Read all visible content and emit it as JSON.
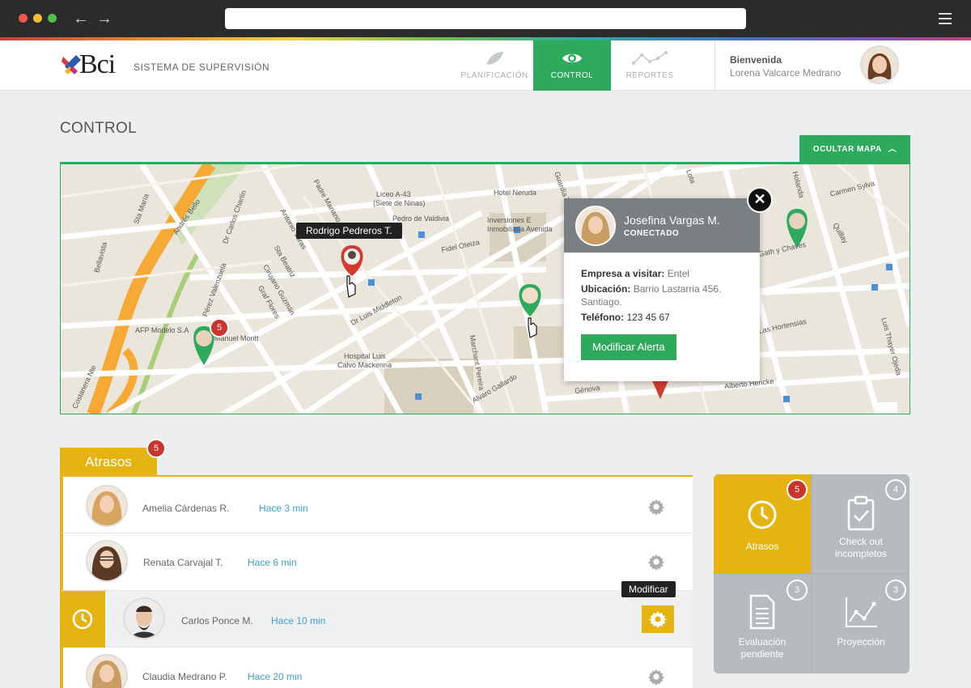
{
  "browser": {
    "back_icon": "←",
    "forward_icon": "→"
  },
  "header": {
    "logo_text": "Bci",
    "system_name": "SISTEMA DE SUPERVISIÓN",
    "nav": [
      {
        "label": "PLANIFICACIÓN",
        "icon": "rocket-icon",
        "active": false
      },
      {
        "label": "CONTROL",
        "icon": "eye-icon",
        "active": true
      },
      {
        "label": "REPORTES",
        "icon": "line-chart-icon",
        "active": false
      }
    ],
    "welcome": "Bienvenida",
    "user_name": "Lorena Valcarce Medrano"
  },
  "page": {
    "title": "CONTROL",
    "hide_map_label": "OCULTAR MAPA"
  },
  "map": {
    "labels": {
      "licee": "Liceo A-43",
      "licee2": "(Siete de Ninas)",
      "hotel": "Hotel Neruda",
      "valdivia": "Pedro de Valdivia",
      "inv1": "Inversiones E",
      "inv2": "Inmobiliaria Avenida",
      "fidel": "Fidel Oteiza",
      "afp": "AFP Modelo S.A",
      "manuel": "Manuel Montt",
      "hospital1": "Hospital Luis",
      "hospital2": "Calvo Mackenna",
      "middleton": "Dr Luis Middleton",
      "genova": "Génova",
      "alberto": "Alberto Hencke",
      "hortensias": "Las Hortensias",
      "carmen": "Carmen Sylva",
      "gath": "Gath y Chaves",
      "bellavista": "Bellavista",
      "santamaria": "Sta María",
      "andres": "Andrés Bello",
      "costanera": "Costanera Nte",
      "marchant": "Marchant Pereira",
      "gallardo": "Alvaro Gallardo",
      "holanda": "Holanda",
      "thayer": "Luis Thayer Ojeda",
      "cirujano": "Cirujano Guzmán",
      "flores": "Graf Flores",
      "beatriz": "Sta Beatriz",
      "paul": "Paul Harris",
      "pedrovald": "Padre Mariano",
      "antonio": "Antonio Varas",
      "charlin": "Dr Carlos Charlín",
      "valenzuela": "Pérez Valenzuela",
      "guardia": "Guardia Vieja",
      "lota": "Lota",
      "quilin": "Quillay"
    },
    "pin_tooltip": "Rodrigo Pedreros T.",
    "cluster_count": "5",
    "popup": {
      "name": "Josefina Vargas M.",
      "status": "CONECTADO",
      "empresa_label": "Empresa a visitar:",
      "empresa_value": "Entel",
      "ubicacion_label": "Ubicación:",
      "ubicacion_value": "Barrio Lastarria 456. Santiago.",
      "telefono_label": "Teléfono:",
      "telefono_value": "123 45 67",
      "button": "Modificar Alerta",
      "close_icon": "✕"
    }
  },
  "atrasos": {
    "tab_label": "Atrasos",
    "badge": "5",
    "rows": [
      {
        "name": "Amelia Cárdenas R.",
        "time": "Hace 3 min"
      },
      {
        "name": "Renata Carvajal T.",
        "time": "Hace 6 min"
      },
      {
        "name": "Carlos Ponce M.",
        "time": "Hace 10 min"
      },
      {
        "name": "Claudia Medrano P.",
        "time": "Hace 20 min"
      }
    ],
    "tooltip": "Modificar"
  },
  "tiles": [
    {
      "label": "Atrasos",
      "count": "5",
      "icon": "clock-icon"
    },
    {
      "label": "Check out incompletos",
      "count": "4",
      "icon": "clipboard-check-icon"
    },
    {
      "label": "Evaluación pendiente",
      "count": "3",
      "icon": "document-icon"
    },
    {
      "label": "Proyección",
      "count": "3",
      "icon": "line-chart-icon"
    }
  ],
  "colors": {
    "green": "#2eaa5c",
    "yellow": "#e6b411",
    "red": "#c8352c",
    "link": "#3ea0cf"
  }
}
